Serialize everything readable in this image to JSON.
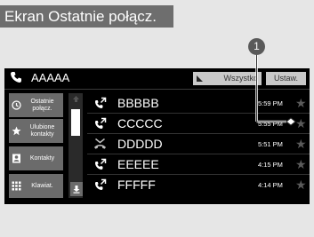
{
  "title": "Ekran Ostatnie połącz.",
  "callout": {
    "number": "1"
  },
  "header": {
    "contact_name": "AAAAA",
    "all_button": "Wszystko",
    "settings_button": "Ustaw."
  },
  "sidebar": {
    "items": [
      {
        "label": "Ostatnie połącz.",
        "icon": "recent-calls-icon"
      },
      {
        "label": "Ulubione kontakty",
        "icon": "star-icon"
      },
      {
        "label": "Kontakty",
        "icon": "contacts-icon"
      },
      {
        "label": "Klawiat.",
        "icon": "keypad-icon"
      }
    ]
  },
  "calls": [
    {
      "name": "BBBBB",
      "time": "5:59 PM",
      "type": "outgoing"
    },
    {
      "name": "CCCCC",
      "time": "5:55 PM",
      "type": "outgoing"
    },
    {
      "name": "DDDDD",
      "time": "5:51 PM",
      "type": "missed"
    },
    {
      "name": "EEEEE",
      "time": "4:15 PM",
      "type": "outgoing"
    },
    {
      "name": "FFFFF",
      "time": "4:14 PM",
      "type": "outgoing"
    }
  ]
}
